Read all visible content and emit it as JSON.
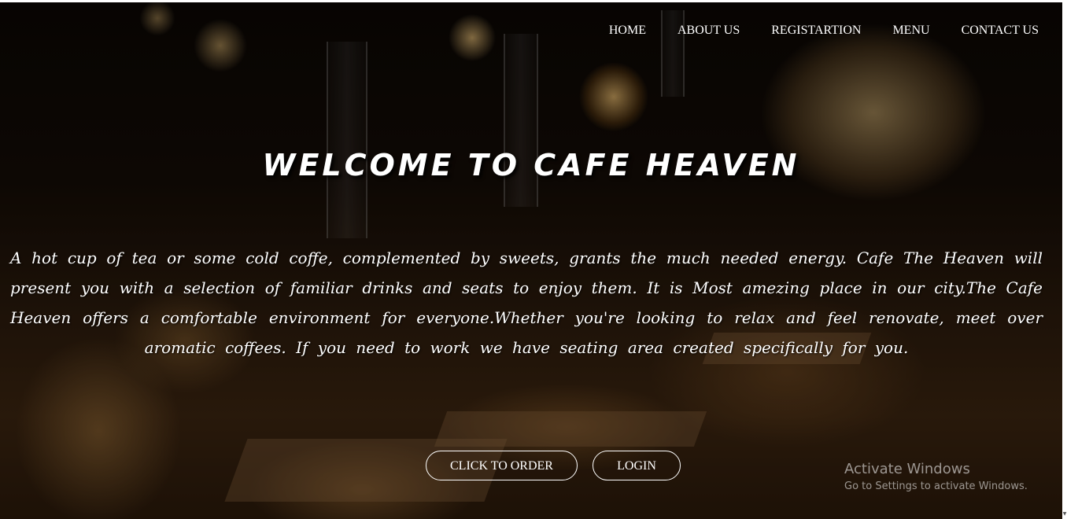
{
  "nav": {
    "items": [
      {
        "label": "HOME"
      },
      {
        "label": "ABOUT US"
      },
      {
        "label": "REGISTARTION"
      },
      {
        "label": "MENU"
      },
      {
        "label": "CONTACT US"
      }
    ]
  },
  "hero": {
    "headline": "WELCOME TO CAFE HEAVEN",
    "paragraph": "A hot cup of tea or some cold coffe, complemented by sweets, grants the much needed energy. Cafe The Heaven will present you with a selection of familiar drinks and seats to enjoy them. It is Most amezing place in our city.The Cafe Heaven offers a comfortable environment for everyone.Whether you're looking to relax and feel renovate, meet over aromatic coffees. If you need to work we have seating area created specifically for you.",
    "order_button": "CLICK TO ORDER",
    "login_button": "LOGIN"
  },
  "watermark": {
    "title": "Activate Windows",
    "subtitle": "Go to Settings to activate Windows."
  },
  "colors": {
    "text": "#ffffff",
    "background": "#140c06"
  }
}
